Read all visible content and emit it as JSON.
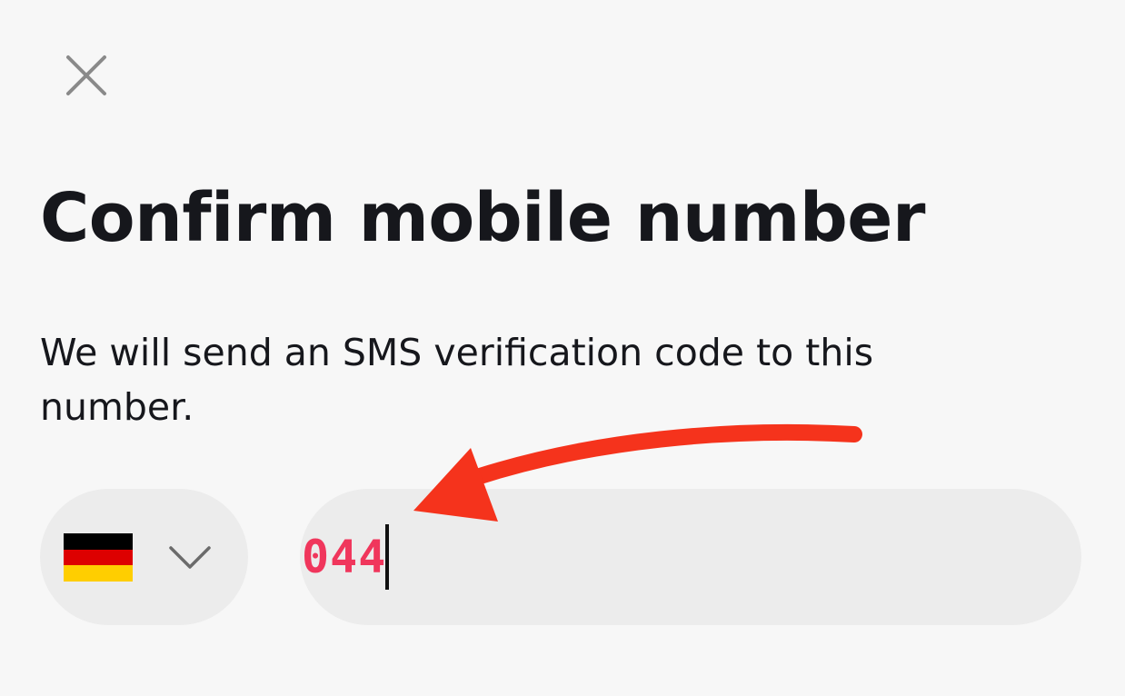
{
  "header": {
    "close_icon": "close-icon"
  },
  "title": "Confirm mobile number",
  "subtitle": "We will send an SMS verification code to this number.",
  "phone": {
    "country": {
      "flag_icon": "flag-germany-icon",
      "chevron_icon": "chevron-down-icon"
    },
    "value": "044"
  },
  "annotation": {
    "arrow_icon": "red-arrow-icon",
    "color": "#f5331c"
  },
  "colors": {
    "background": "#f7f7f7",
    "field_background": "#ececec",
    "text": "#16171c",
    "input_text": "#f0365c",
    "close_icon": "#8a8a8a"
  }
}
